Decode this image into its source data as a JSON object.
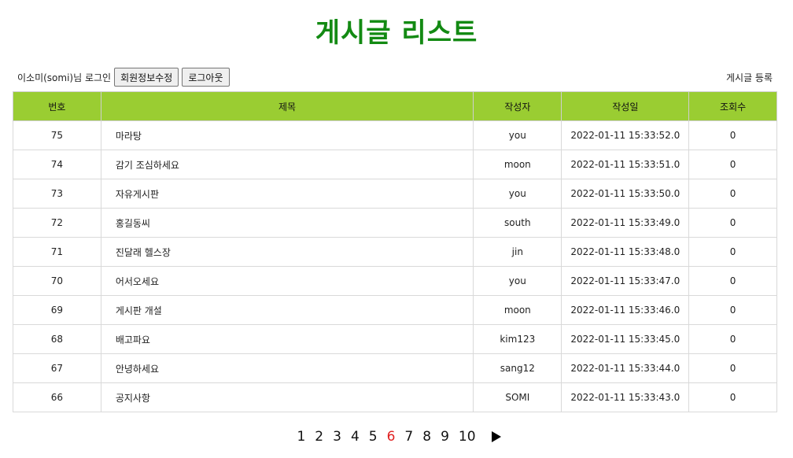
{
  "page": {
    "title": "게시글 리스트"
  },
  "userbar": {
    "greeting": "이소미(somi)님 로그인",
    "edit_profile_label": "회원정보수정",
    "logout_label": "로그아웃"
  },
  "write_link": "게시글 등록",
  "table": {
    "headers": {
      "no": "번호",
      "title": "제목",
      "writer": "작성자",
      "date": "작성일",
      "views": "조회수"
    },
    "rows": [
      {
        "no": "75",
        "title": "마라탕",
        "writer": "you",
        "date": "2022-01-11 15:33:52.0",
        "views": "0"
      },
      {
        "no": "74",
        "title": "감기 조심하세요",
        "writer": "moon",
        "date": "2022-01-11 15:33:51.0",
        "views": "0"
      },
      {
        "no": "73",
        "title": "자유게시판",
        "writer": "you",
        "date": "2022-01-11 15:33:50.0",
        "views": "0"
      },
      {
        "no": "72",
        "title": "홍길동씨",
        "writer": "south",
        "date": "2022-01-11 15:33:49.0",
        "views": "0"
      },
      {
        "no": "71",
        "title": "진달래 헬스장",
        "writer": "jin",
        "date": "2022-01-11 15:33:48.0",
        "views": "0"
      },
      {
        "no": "70",
        "title": "어서오세요",
        "writer": "you",
        "date": "2022-01-11 15:33:47.0",
        "views": "0"
      },
      {
        "no": "69",
        "title": "게시판 개설",
        "writer": "moon",
        "date": "2022-01-11 15:33:46.0",
        "views": "0"
      },
      {
        "no": "68",
        "title": "배고파요",
        "writer": "kim123",
        "date": "2022-01-11 15:33:45.0",
        "views": "0"
      },
      {
        "no": "67",
        "title": "안녕하세요",
        "writer": "sang12",
        "date": "2022-01-11 15:33:44.0",
        "views": "0"
      },
      {
        "no": "66",
        "title": "공지사항",
        "writer": "SOMI",
        "date": "2022-01-11 15:33:43.0",
        "views": "0"
      }
    ]
  },
  "pagination": {
    "pages": [
      "1",
      "2",
      "3",
      "4",
      "5",
      "6",
      "7",
      "8",
      "9",
      "10"
    ],
    "current": "6",
    "next_icon": "triangle-right-icon"
  },
  "colors": {
    "title_green": "#138a13",
    "header_bg": "#9acd32",
    "current_page": "#e02020"
  }
}
